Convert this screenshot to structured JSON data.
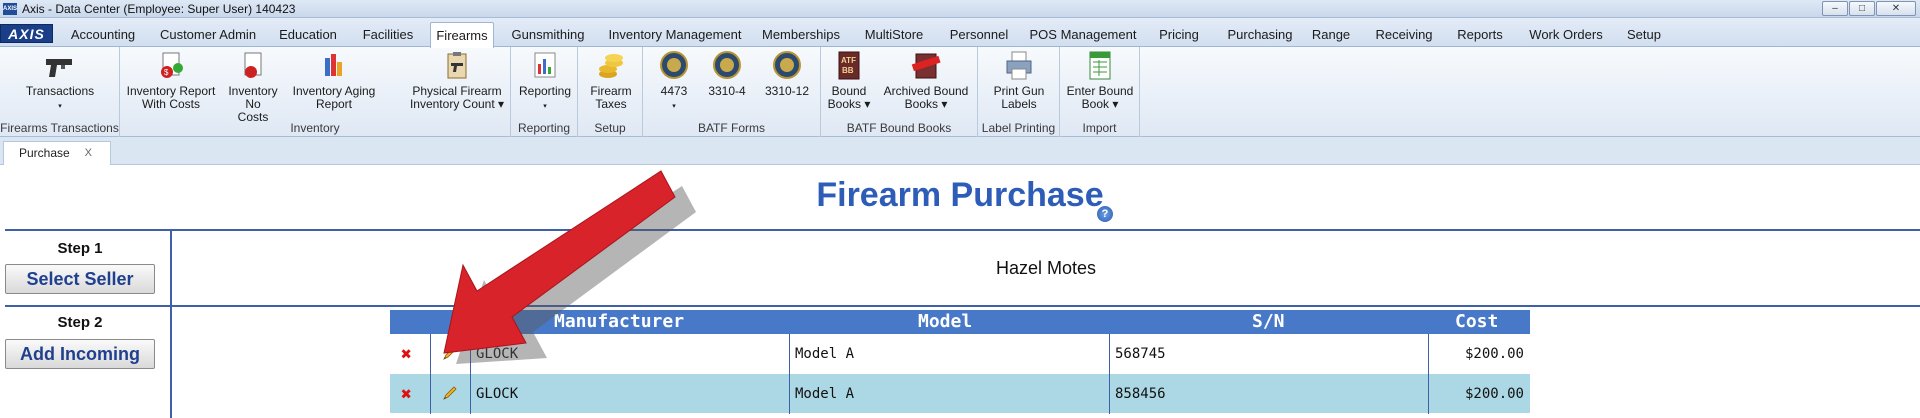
{
  "window": {
    "title": "Axis - Data Center  (Employee: Super User) 140423",
    "controls": [
      "–",
      "□",
      "✕"
    ]
  },
  "menu": {
    "logo": "AXIS",
    "tabs": [
      "Accounting",
      "Customer Admin",
      "Education",
      "Facilities",
      "Firearms",
      "Gunsmithing",
      "Inventory Management",
      "Memberships",
      "MultiStore",
      "Personnel",
      "POS Management",
      "Pricing",
      "Purchasing",
      "Range",
      "Receiving",
      "Reports",
      "Work Orders",
      "Setup"
    ],
    "active": "Firearms"
  },
  "ribbon": {
    "groups": [
      {
        "label": "Firearms Transactions",
        "buttons": [
          {
            "line1": "Transactions",
            "line2": "▾",
            "icon": "pistol-icon"
          }
        ]
      },
      {
        "label": "Inventory",
        "buttons": [
          {
            "line1": "Inventory Report",
            "line2": "With Costs",
            "icon": "report-dollar-icon"
          },
          {
            "line1": "Inventory No",
            "line2": "Costs",
            "icon": "report-icon"
          },
          {
            "line1": "Inventory Aging",
            "line2": "Report",
            "icon": "bar-chart-icon"
          },
          {
            "line1": "Physical Firearm",
            "line2": "Inventory Count ▾",
            "icon": "clipboard-pistol-icon"
          }
        ]
      },
      {
        "label": "Reporting",
        "buttons": [
          {
            "line1": "Reporting",
            "line2": "▾",
            "icon": "reporting-chart-icon"
          }
        ]
      },
      {
        "label": "Setup",
        "buttons": [
          {
            "line1": "Firearm",
            "line2": "Taxes",
            "icon": "coins-icon"
          }
        ]
      },
      {
        "label": "BATF Forms",
        "buttons": [
          {
            "line1": "4473",
            "line2": "▾",
            "icon": "batf-seal-icon"
          },
          {
            "line1": "3310-4",
            "line2": "",
            "icon": "batf-seal-icon"
          },
          {
            "line1": "3310-12",
            "line2": "",
            "icon": "batf-seal-icon"
          }
        ]
      },
      {
        "label": "BATF Bound Books",
        "buttons": [
          {
            "line1": "Bound",
            "line2": "Books ▾",
            "icon": "bound-book-icon"
          },
          {
            "line1": "Archived Bound",
            "line2": "Books ▾",
            "icon": "archived-book-icon"
          }
        ]
      },
      {
        "label": "Label Printing",
        "buttons": [
          {
            "line1": "Print Gun",
            "line2": "Labels",
            "icon": "printer-icon"
          }
        ]
      },
      {
        "label": "Import",
        "buttons": [
          {
            "line1": "Enter Bound",
            "line2": "Book ▾",
            "icon": "spreadsheet-icon"
          }
        ]
      }
    ]
  },
  "doc_tab": {
    "label": "Purchase",
    "close": "X"
  },
  "page": {
    "title": "Firearm Purchase",
    "help": "?",
    "step1": {
      "label": "Step 1",
      "button": "Select Seller",
      "seller": "Hazel  Motes"
    },
    "step2": {
      "label": "Step 2",
      "button": "Add Incoming"
    }
  },
  "table": {
    "headers": [
      "Manufacturer",
      "Model",
      "S/N",
      "Cost"
    ],
    "rows": [
      {
        "manufacturer": "GLOCK",
        "model": "Model A",
        "sn": "568745",
        "cost": "$200.00"
      },
      {
        "manufacturer": "GLOCK",
        "model": "Model A",
        "sn": "858456",
        "cost": "$200.00"
      }
    ]
  },
  "colors": {
    "accent": "#2e5db8",
    "header_bg": "#4879c9",
    "alt_row": "#acd8e6",
    "arrow": "#d9232b"
  }
}
